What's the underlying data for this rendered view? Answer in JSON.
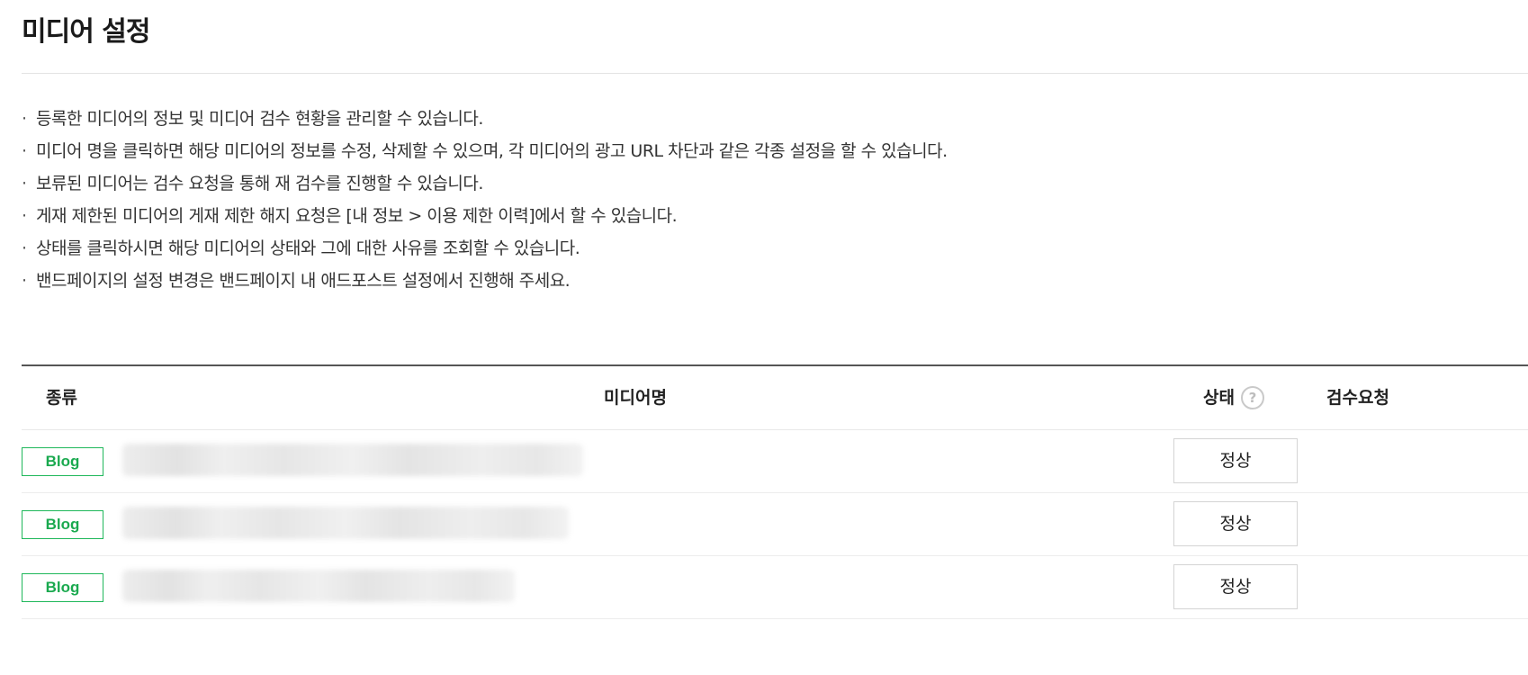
{
  "page": {
    "title": "미디어 설정"
  },
  "notices": [
    {
      "bullet": "·",
      "text": "등록한 미디어의 정보 및 미디어 검수 현황을 관리할 수 있습니다."
    },
    {
      "bullet": "·",
      "text": "미디어 명을 클릭하면 해당 미디어의 정보를 수정, 삭제할 수 있으며, 각 미디어의 광고 URL 차단과 같은 각종 설정을 할 수 있습니다."
    },
    {
      "bullet": "·",
      "text": "보류된 미디어는 검수 요청을 통해 재 검수를 진행할 수 있습니다."
    },
    {
      "bullet": "·",
      "text": "게재 제한된 미디어의 게재 제한 해지 요청은 [내 정보 > 이용 제한 이력]에서 할 수 있습니다."
    },
    {
      "bullet": "·",
      "text": "상태를 클릭하시면 해당 미디어의 상태와 그에 대한 사유를 조회할 수 있습니다."
    },
    {
      "bullet": "·",
      "text": "밴드페이지의 설정 변경은 밴드페이지 내 애드포스트 설정에서 진행해 주세요."
    }
  ],
  "table": {
    "headers": {
      "type": "종류",
      "name": "미디어명",
      "status": "상태",
      "status_help": "?",
      "review": "검수요청"
    },
    "rows": [
      {
        "type": "Blog",
        "name": "",
        "status": "정상",
        "review": ""
      },
      {
        "type": "Blog",
        "name": "",
        "status": "정상",
        "review": ""
      },
      {
        "type": "Blog",
        "name": "",
        "status": "정상",
        "review": ""
      }
    ]
  },
  "colors": {
    "badge_green": "#1fb75b",
    "table_top_border": "#555555",
    "divider": "#e3e3e3"
  },
  "icons": {
    "status_help": "question-circle-icon"
  }
}
